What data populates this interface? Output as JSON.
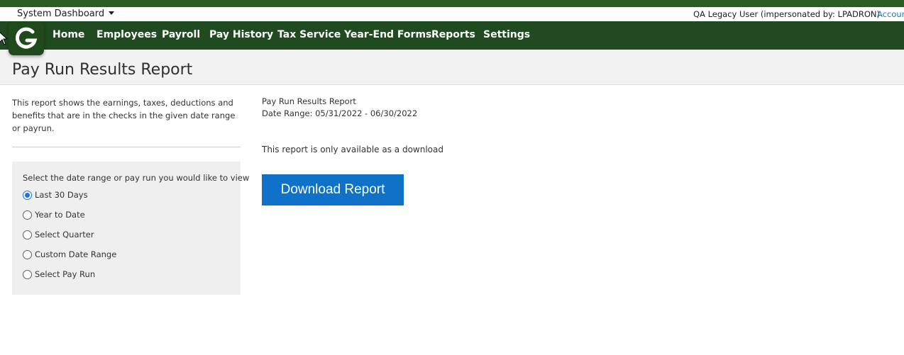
{
  "header": {
    "dashboard_label": "System Dashboard",
    "user_info": "QA Legacy User (impersonated by: LPADRON)",
    "account_label": "Accour"
  },
  "nav": {
    "items": [
      {
        "label": "Home"
      },
      {
        "label": "Employees"
      },
      {
        "label": "Payroll"
      },
      {
        "label": "Pay History"
      },
      {
        "label": "Tax Service"
      },
      {
        "label": "Year-End Forms"
      },
      {
        "label": "Reports"
      },
      {
        "label": "Settings"
      }
    ]
  },
  "page": {
    "title": "Pay Run Results Report"
  },
  "sidebar": {
    "description": "This report shows the earnings, taxes, deductions and benefits that are in the checks in the given date range or payrun.",
    "prompt": "Select the date range or pay run you would like to view",
    "options": [
      {
        "label": "Last 30 Days",
        "selected": true
      },
      {
        "label": "Year to Date",
        "selected": false
      },
      {
        "label": "Select Quarter",
        "selected": false
      },
      {
        "label": "Custom Date Range",
        "selected": false
      },
      {
        "label": "Select Pay Run",
        "selected": false
      }
    ]
  },
  "report": {
    "name": "Pay Run Results Report",
    "date_range": "Date Range: 05/31/2022 - 06/30/2022",
    "availability_note": "This report is only available as a download",
    "download_label": "Download Report"
  },
  "colors": {
    "nav_bg": "#204a1f",
    "top_strip": "#2b5b23",
    "button_bg": "#0f72c8",
    "link": "#1a7fc6",
    "radio_selected": "#1a73e8"
  }
}
